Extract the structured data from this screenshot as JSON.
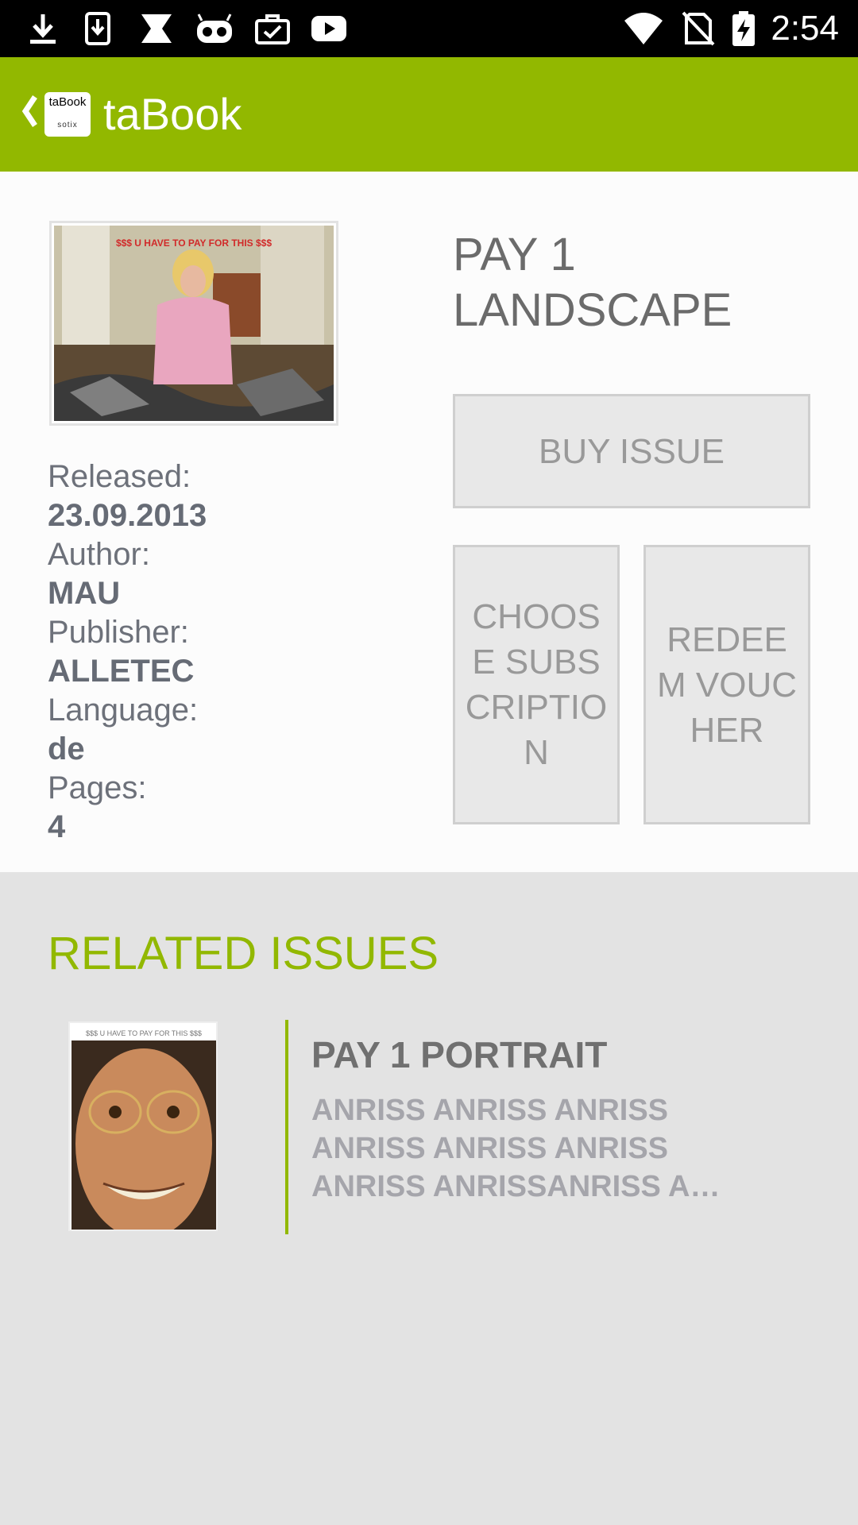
{
  "status_bar": {
    "time": "2:54",
    "icons": [
      "download-icon",
      "download-box-icon",
      "shield-x-icon",
      "robot-icon",
      "briefcase-check-icon",
      "youtube-icon",
      "wifi-icon",
      "no-sim-icon",
      "battery-charging-icon"
    ]
  },
  "app_bar": {
    "title": "taBook",
    "logo_text": "taBook",
    "logo_sub": "sotix",
    "back_icon": "chevron-left-icon"
  },
  "issue": {
    "title": "PAY 1 LANDSCAPE",
    "cover_caption": "$$$ U HAVE TO PAY FOR THIS $$$",
    "meta": [
      {
        "label": "Released:",
        "value": "23.09.2013"
      },
      {
        "label": "Author:",
        "value": "MAU"
      },
      {
        "label": "Publisher:",
        "value": "ALLETEC"
      },
      {
        "label": "Language:",
        "value": "de"
      },
      {
        "label": "Pages:",
        "value": "4"
      }
    ],
    "buttons": {
      "buy": "BUY ISSUE",
      "subscription": "CHOOSE SUBSCRIPTION",
      "voucher": "REDEEM VOUCHER"
    }
  },
  "related": {
    "heading": "RELATED ISSUES",
    "items": [
      {
        "title": "PAY 1 PORTRAIT",
        "thumb_caption": "$$$ U HAVE TO PAY FOR THIS $$$",
        "description": "ANRISS ANRISS ANRISS ANRISS ANRISS ANRISS ANRISS ANRISSANRISS A…"
      }
    ]
  },
  "colors": {
    "accent": "#92b800",
    "status_bar": "#000000",
    "button_bg": "#e8e8e8",
    "related_bg": "#e3e3e3"
  }
}
